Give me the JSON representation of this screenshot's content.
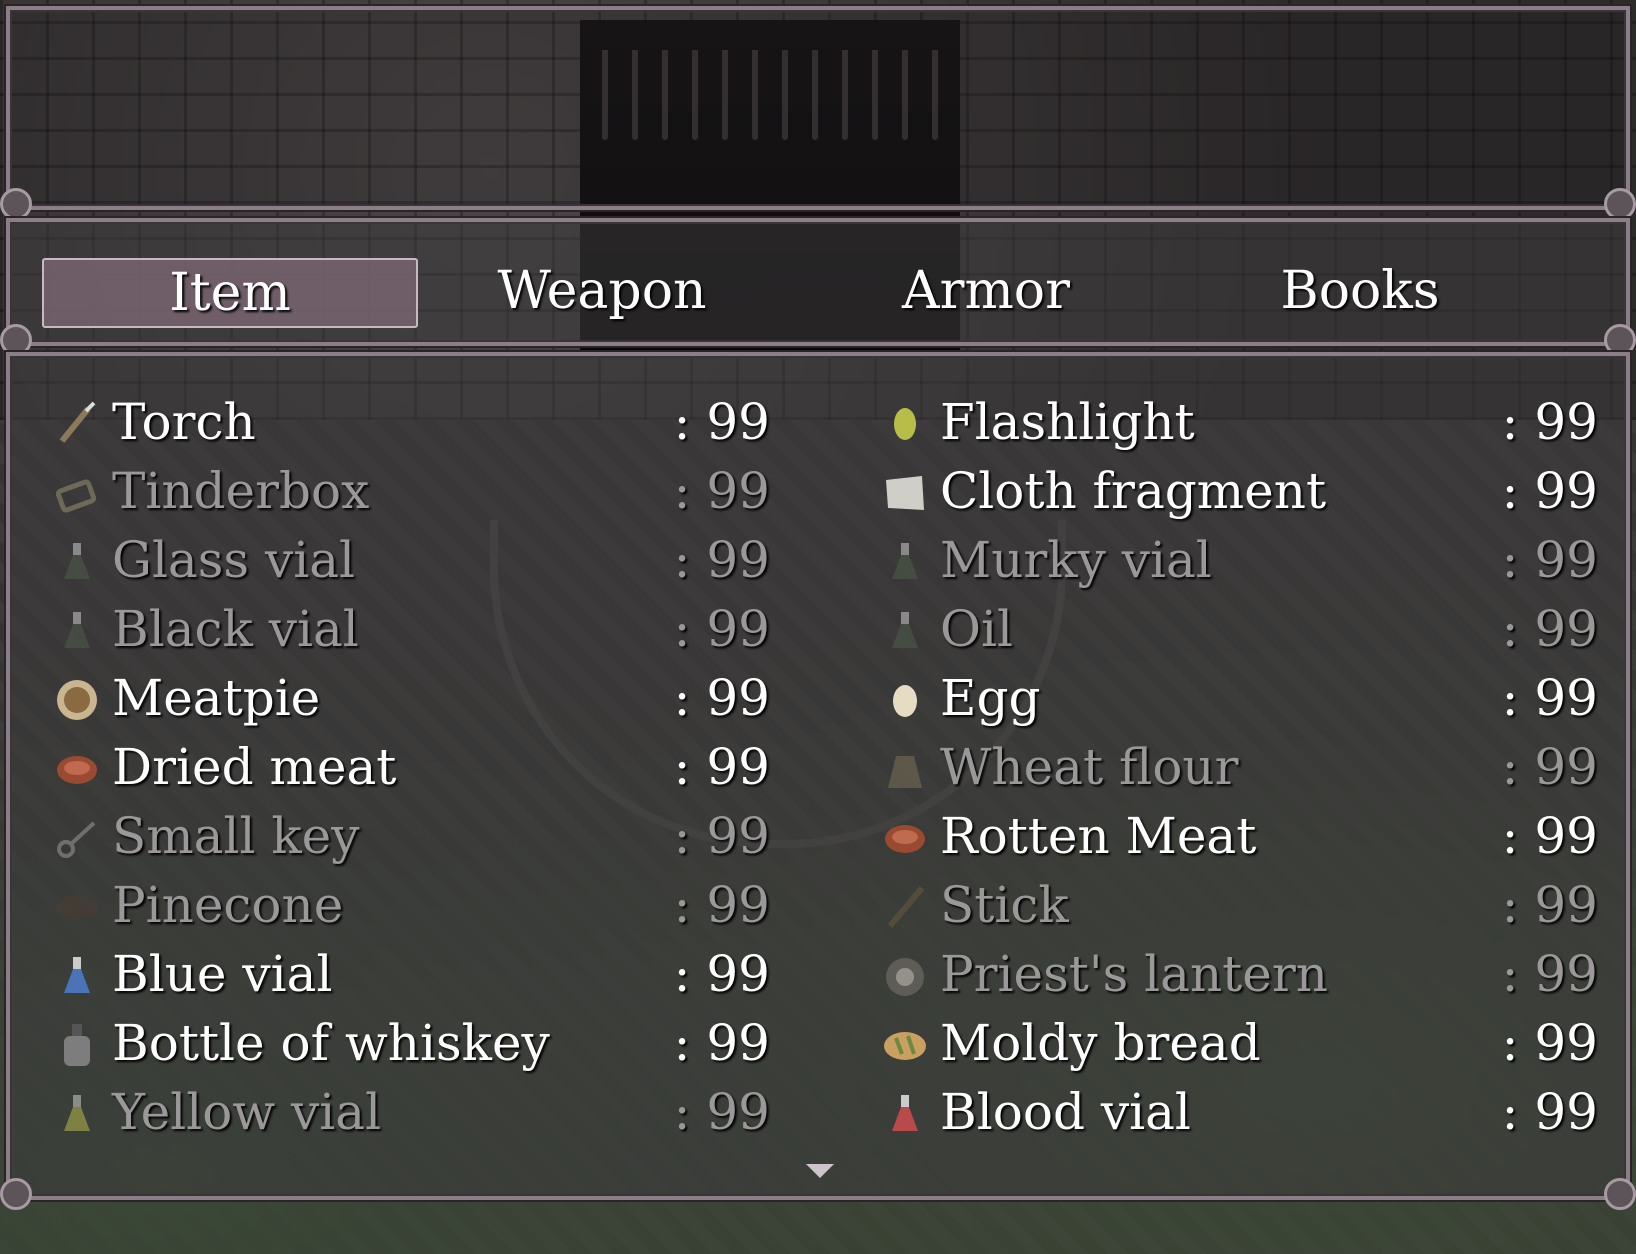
{
  "tabs": [
    {
      "label": "Item",
      "selected": true
    },
    {
      "label": "Weapon",
      "selected": false
    },
    {
      "label": "Armor",
      "selected": false
    },
    {
      "label": "Books",
      "selected": false
    }
  ],
  "items_left": [
    {
      "name": "Torch",
      "count": ": 99",
      "enabled": true,
      "icon": "torch-icon"
    },
    {
      "name": "Tinderbox",
      "count": ": 99",
      "enabled": false,
      "icon": "tinderbox-icon"
    },
    {
      "name": "Glass vial",
      "count": ": 99",
      "enabled": false,
      "icon": "vial-icon"
    },
    {
      "name": "Black vial",
      "count": ": 99",
      "enabled": false,
      "icon": "vial-icon"
    },
    {
      "name": "Meatpie",
      "count": ": 99",
      "enabled": true,
      "icon": "meatpie-icon"
    },
    {
      "name": "Dried meat",
      "count": ": 99",
      "enabled": true,
      "icon": "meat-icon"
    },
    {
      "name": "Small key",
      "count": ": 99",
      "enabled": false,
      "icon": "key-icon"
    },
    {
      "name": "Pinecone",
      "count": ": 99",
      "enabled": false,
      "icon": "pinecone-icon"
    },
    {
      "name": "Blue vial",
      "count": ": 99",
      "enabled": true,
      "icon": "vial-icon"
    },
    {
      "name": "Bottle of whiskey",
      "count": ": 99",
      "enabled": true,
      "icon": "bottle-icon"
    },
    {
      "name": "Yellow vial",
      "count": ": 99",
      "enabled": false,
      "icon": "vial-icon"
    }
  ],
  "items_right": [
    {
      "name": "Flashlight",
      "count": ": 99",
      "enabled": true,
      "icon": "flashlight-icon"
    },
    {
      "name": "Cloth fragment",
      "count": ": 99",
      "enabled": true,
      "icon": "cloth-icon"
    },
    {
      "name": "Murky vial",
      "count": ": 99",
      "enabled": false,
      "icon": "vial-icon"
    },
    {
      "name": "Oil",
      "count": ": 99",
      "enabled": false,
      "icon": "vial-icon"
    },
    {
      "name": "Egg",
      "count": ": 99",
      "enabled": true,
      "icon": "egg-icon"
    },
    {
      "name": "Wheat flour",
      "count": ": 99",
      "enabled": false,
      "icon": "sack-icon"
    },
    {
      "name": "Rotten Meat",
      "count": ": 99",
      "enabled": true,
      "icon": "meat-icon"
    },
    {
      "name": "Stick",
      "count": ": 99",
      "enabled": false,
      "icon": "stick-icon"
    },
    {
      "name": "Priest's lantern",
      "count": ": 99",
      "enabled": false,
      "icon": "lantern-icon"
    },
    {
      "name": "Moldy bread",
      "count": ": 99",
      "enabled": true,
      "icon": "bread-icon"
    },
    {
      "name": "Blood vial",
      "count": ": 99",
      "enabled": true,
      "icon": "vial-icon"
    }
  ],
  "colors": {
    "enabled_text": "#ffffff",
    "disabled_text": "#9a9898",
    "selected_tab": "#786470",
    "vial_blue": "#4a73b8",
    "vial_yellow": "#b8b84a",
    "vial_red": "#b84a4a",
    "vial_dark": "#4d5c4a"
  }
}
